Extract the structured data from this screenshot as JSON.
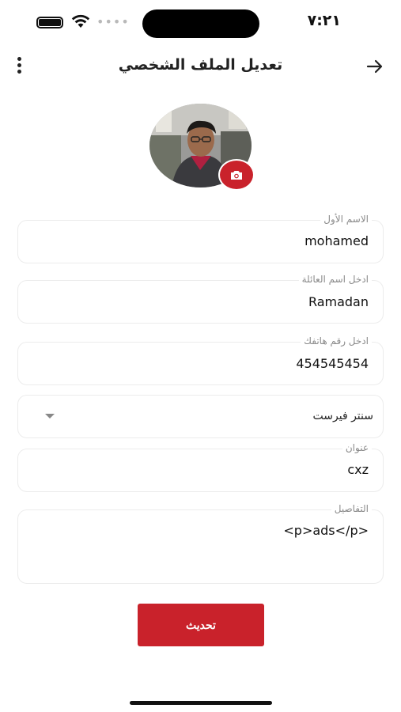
{
  "status_bar": {
    "time": "٧:٢١"
  },
  "header": {
    "title": "تعديل الملف الشخصي"
  },
  "icons": {
    "back": "arrow-right-icon",
    "menu": "more-vertical-icon",
    "camera": "camera-icon"
  },
  "form": {
    "first_name": {
      "label": "الاسم الأول",
      "value": "mohamed"
    },
    "last_name": {
      "label": "ادخل اسم العائلة",
      "value": "Ramadan"
    },
    "phone": {
      "label": "ادخل رقم هاتفك",
      "value": "454545454"
    },
    "center": {
      "value": "سنتر فيرست"
    },
    "address": {
      "label": "عنوان",
      "value": "cxz"
    },
    "details": {
      "label": "التفاصيل",
      "value": "<p>ads</p>"
    }
  },
  "actions": {
    "update_label": "تحديث"
  },
  "colors": {
    "accent": "#c9222b",
    "text": "#111111",
    "label": "#8a8a8a",
    "border": "#ececec"
  }
}
